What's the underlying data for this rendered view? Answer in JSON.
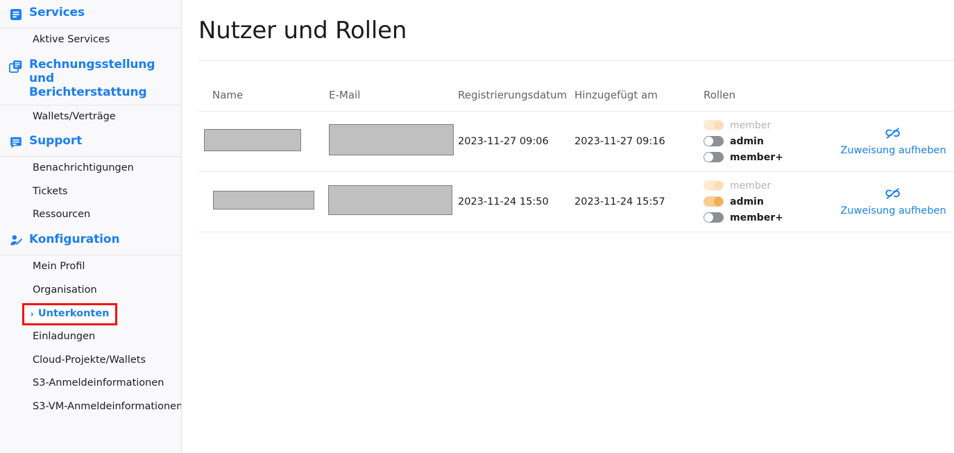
{
  "sidebar": {
    "sections": [
      {
        "id": "services",
        "label": "Services",
        "icon": "document-icon",
        "items": [
          {
            "label": "Aktive Services"
          }
        ]
      },
      {
        "id": "billing",
        "label": "Rechnungsstellung und Berichterstattung",
        "icon": "documents-stack-icon",
        "items": [
          {
            "label": "Wallets/Verträge"
          }
        ]
      },
      {
        "id": "support",
        "label": "Support",
        "icon": "speech-bubble-icon",
        "items": [
          {
            "label": "Benachrichtigungen"
          },
          {
            "label": "Tickets"
          },
          {
            "label": "Ressourcen"
          }
        ]
      },
      {
        "id": "configuration",
        "label": "Konfiguration",
        "icon": "user-edit-icon",
        "items": [
          {
            "label": "Mein Profil"
          },
          {
            "label": "Organisation"
          },
          {
            "label": "Unterkonten",
            "active": true,
            "chevron": "›"
          },
          {
            "label": "Einladungen"
          },
          {
            "label": "Cloud-Projekte/Wallets"
          },
          {
            "label": "S3-Anmeldeinformationen"
          },
          {
            "label": "S3-VM-Anmeldeinformationen"
          }
        ]
      }
    ],
    "accent_color": "#1a7ff0",
    "highlight_color": "#fc0d0d",
    "background_color": "#f9f9fc"
  },
  "main": {
    "page_title": "Nutzer und Rollen",
    "table": {
      "headers": {
        "name": "Name",
        "email": "E-Mail",
        "registration_date": "Registrierungsdatum",
        "added_on": "Hinzugefügt am",
        "roles": "Rollen",
        "actions": ""
      },
      "rows": [
        {
          "name": "",
          "email": "",
          "registration_date": "2023-11-27 09:06",
          "added_on": "2023-11-27 09:16",
          "roles": [
            {
              "label": "member",
              "state": "on-disabled"
            },
            {
              "label": "admin",
              "state": "off"
            },
            {
              "label": "member+",
              "state": "off"
            }
          ],
          "action": {
            "icon": "unlink-icon",
            "label": "Zuweisung aufheben"
          }
        },
        {
          "name": "",
          "email": "",
          "registration_date": "2023-11-24 15:50",
          "added_on": "2023-11-24 15:57",
          "roles": [
            {
              "label": "member",
              "state": "on-disabled"
            },
            {
              "label": "admin",
              "state": "on"
            },
            {
              "label": "member+",
              "state": "off"
            }
          ],
          "action": {
            "icon": "unlink-icon",
            "label": "Zuweisung aufheben"
          }
        }
      ]
    },
    "colors": {
      "toggle_on": "#f2ad58",
      "toggle_on_track": "#f8cd94",
      "toggle_on_disabled": "#fdead1",
      "toggle_off": "#8d8f93",
      "link": "#1a7ff0",
      "redaction": "#c0c0c0"
    }
  }
}
